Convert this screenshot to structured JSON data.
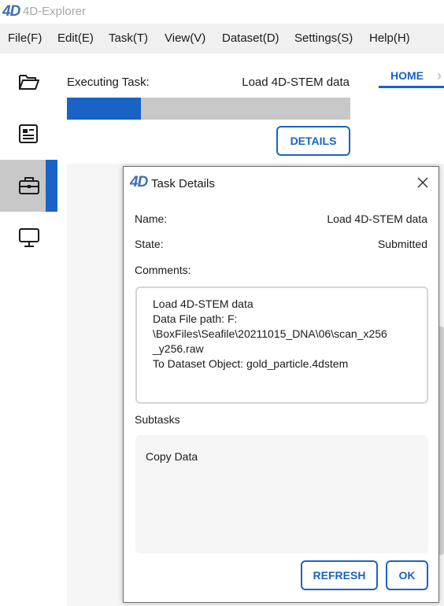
{
  "app": {
    "logo": "4D",
    "title": "4D-Explorer"
  },
  "menu": {
    "items": [
      "File(F)",
      "Edit(E)",
      "Task(T)",
      "View(V)",
      "Dataset(D)",
      "Settings(S)",
      "Help(H)"
    ]
  },
  "sidebar": {
    "items": [
      {
        "icon": "folder-open-icon",
        "active": false
      },
      {
        "icon": "id-card-icon",
        "active": false
      },
      {
        "icon": "briefcase-icon",
        "active": true
      },
      {
        "icon": "monitor-icon",
        "active": false
      }
    ]
  },
  "main": {
    "executing_label": "Executing Task:",
    "executing_task": "Load 4D-STEM data",
    "progress_fraction": 0.26,
    "details_label": "DETAILS",
    "home_tab_label": "HOME",
    "home_tab_arrow": "›"
  },
  "dialog": {
    "logo": "4D",
    "title": "Task Details",
    "name_label": "Name:",
    "name_value": "Load 4D-STEM data",
    "state_label": "State:",
    "state_value": "Submitted",
    "comments_label": "Comments:",
    "comments_text": "Load 4D-STEM data\nData File path: F:\n\\BoxFiles\\Seafile\\20211015_DNA\\06\\scan_x256\n_y256.raw\nTo Dataset Object: gold_particle.4dstem",
    "subtasks_label": "Subtasks",
    "subtasks": [
      "Copy Data"
    ],
    "refresh_label": "REFRESH",
    "ok_label": "OK"
  },
  "colors": {
    "accent": "#1a63c4",
    "progress_track": "#c8c8c8",
    "menubar_bg": "#f0f0f0",
    "sidebar_active_bg": "#c8c8c8"
  }
}
